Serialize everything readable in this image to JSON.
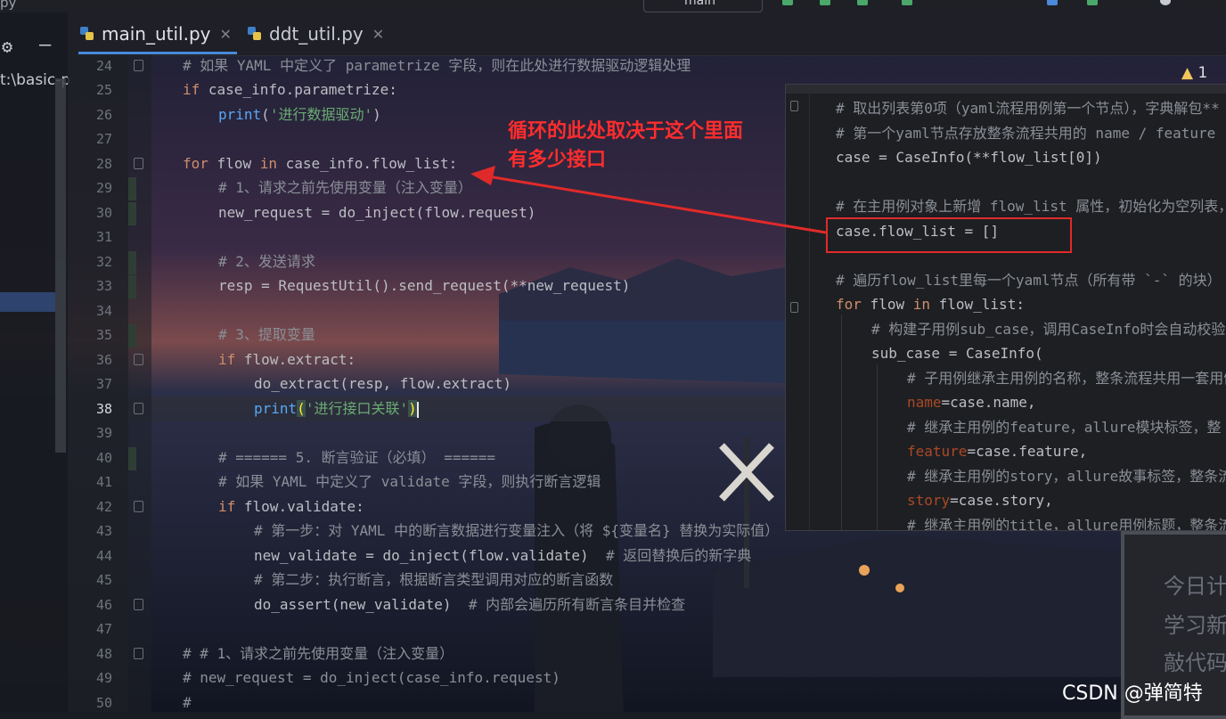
{
  "top": {
    "filename": "py",
    "branch": "main"
  },
  "sidebar": {
    "project_label": "t:\\basic-p"
  },
  "tabs": [
    {
      "label": "main_util.py",
      "active": true
    },
    {
      "label": "ddt_util.py",
      "active": false
    }
  ],
  "editor": {
    "current_line": "38",
    "lines": [
      {
        "n": "24",
        "code": "# 如果 YAML 中定义了 parametrize 字段，则在此处进行数据驱动逻辑处理"
      },
      {
        "n": "25",
        "code": "if case_info.parametrize:"
      },
      {
        "n": "26",
        "code": "print('进行数据驱动')"
      },
      {
        "n": "27",
        "code": ""
      },
      {
        "n": "28",
        "code": "for flow in case_info.flow_list:"
      },
      {
        "n": "29",
        "code": "# 1、请求之前先使用变量（注入变量）"
      },
      {
        "n": "30",
        "code": "new_request = do_inject(flow.request)"
      },
      {
        "n": "31",
        "code": ""
      },
      {
        "n": "32",
        "code": "# 2、发送请求"
      },
      {
        "n": "33",
        "code": "resp = RequestUtil().send_request(**new_request)"
      },
      {
        "n": "34",
        "code": ""
      },
      {
        "n": "35",
        "code": "# 3、提取变量"
      },
      {
        "n": "36",
        "code": "if flow.extract:"
      },
      {
        "n": "37",
        "code": "do_extract(resp, flow.extract)"
      },
      {
        "n": "38",
        "code": "print('进行接口关联')"
      },
      {
        "n": "39",
        "code": ""
      },
      {
        "n": "40",
        "code": "# ====== 5. 断言验证（必填） ======"
      },
      {
        "n": "41",
        "code": "# 如果 YAML 中定义了 validate 字段，则执行断言逻辑"
      },
      {
        "n": "42",
        "code": "if flow.validate:"
      },
      {
        "n": "43",
        "code": "# 第一步：对 YAML 中的断言数据进行变量注入（将 ${变量名} 替换为实际值）"
      },
      {
        "n": "44",
        "code": "new_validate = do_inject(flow.validate)  # 返回替换后的新字典"
      },
      {
        "n": "45",
        "code": "# 第二步：执行断言，根据断言类型调用对应的断言函数"
      },
      {
        "n": "46",
        "code": "do_assert(new_validate)  # 内部会遍历所有断言条目并检查"
      },
      {
        "n": "47",
        "code": ""
      },
      {
        "n": "48",
        "code": "# # 1、请求之前先使用变量（注入变量）"
      },
      {
        "n": "49",
        "code": "# new_request = do_inject(case_info.request)"
      },
      {
        "n": "50",
        "code": "#"
      }
    ]
  },
  "popup": {
    "lines": [
      "# 取出列表第0项（yaml流程用例第一个节点），字典解包**",
      "# 第一个yaml节点存放整条流程共用的 name / feature",
      "case = CaseInfo(**flow_list[0])",
      "",
      "# 在主用例对象上新增 flow_list 属性，初始化为空列表，",
      "case.flow_list = []",
      "",
      "# 遍历flow_list里每一个yaml节点（所有带 `-` 的块）",
      "for flow in flow_list:",
      "# 构建子用例sub_case，调用CaseInfo时会自动校验",
      "sub_case = CaseInfo(",
      "# 子用例继承主用例的名称，整条流程共用一套用例",
      "name=case.name,",
      "# 继承主用例的feature，allure模块标签，整",
      "feature=case.feature,",
      "# 继承主用例的story，allure故事标签，整条流",
      "story=case.story,",
      "# 继承主用例的title，allure用例标题，整条流"
    ]
  },
  "warnings": {
    "count": "1"
  },
  "annotation": {
    "line1": "循环的此处取决于这个里面",
    "line2": "有多少接口"
  },
  "background_board": {
    "line1": "今日计",
    "line2": "学习新",
    "line3": "敲代码"
  },
  "watermark": "CSDN @弹简特",
  "colors": {
    "keyword": "#cf8e6d",
    "comment": "#8a8f97",
    "string": "#6aab73",
    "function": "#56a8f5",
    "param": "#aa4926",
    "annotation": "#ff2d2d",
    "tab_accent": "#4a89dc"
  }
}
